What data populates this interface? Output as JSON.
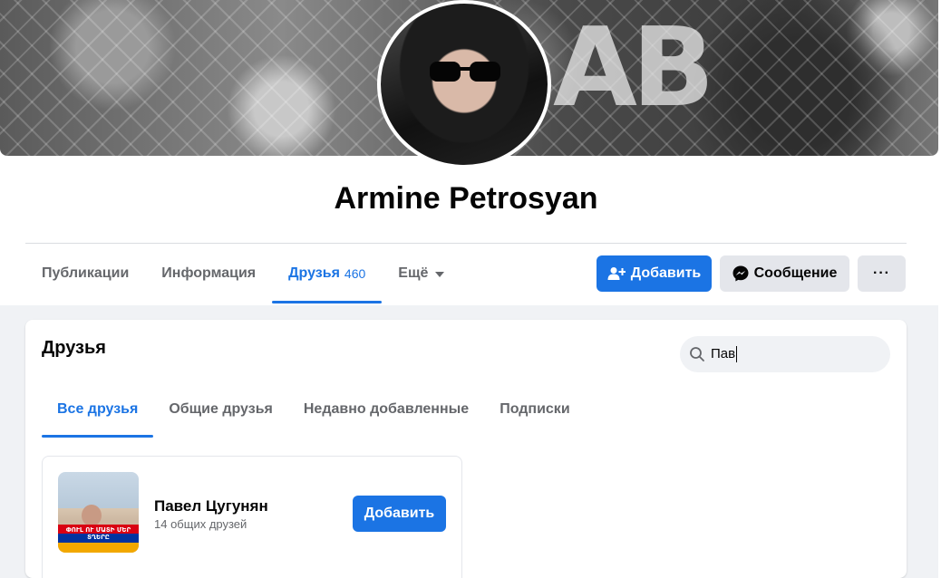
{
  "profile": {
    "name": "Armine Petrosyan",
    "cover_text": "AB"
  },
  "profile_tabs": [
    {
      "label": "Публикации"
    },
    {
      "label": "Информация"
    },
    {
      "label": "Друзья",
      "count": "460",
      "active": true
    },
    {
      "label": "Ещё"
    }
  ],
  "actions": {
    "add_label": "Добавить",
    "message_label": "Сообщение",
    "more_label": "···"
  },
  "friends_section": {
    "title": "Друзья",
    "search": {
      "value": "Пав",
      "icon": "search-icon"
    },
    "tabs": [
      {
        "label": "Все друзья",
        "active": true
      },
      {
        "label": "Общие друзья"
      },
      {
        "label": "Недавно добавленные"
      },
      {
        "label": "Подписки"
      }
    ],
    "results": [
      {
        "name": "Павел Цугунян",
        "mutual": "14 общих друзей",
        "add_label": "Добавить",
        "photo_caption": "ՓՈՒԼ ՈՒ ՄԱՏԻ ՄԵՐ ՏՂԵՐԸ"
      }
    ]
  },
  "colors": {
    "accent": "#1b74e4",
    "secondary_button": "#e4e6eb",
    "page_background": "#f0f2f5"
  }
}
